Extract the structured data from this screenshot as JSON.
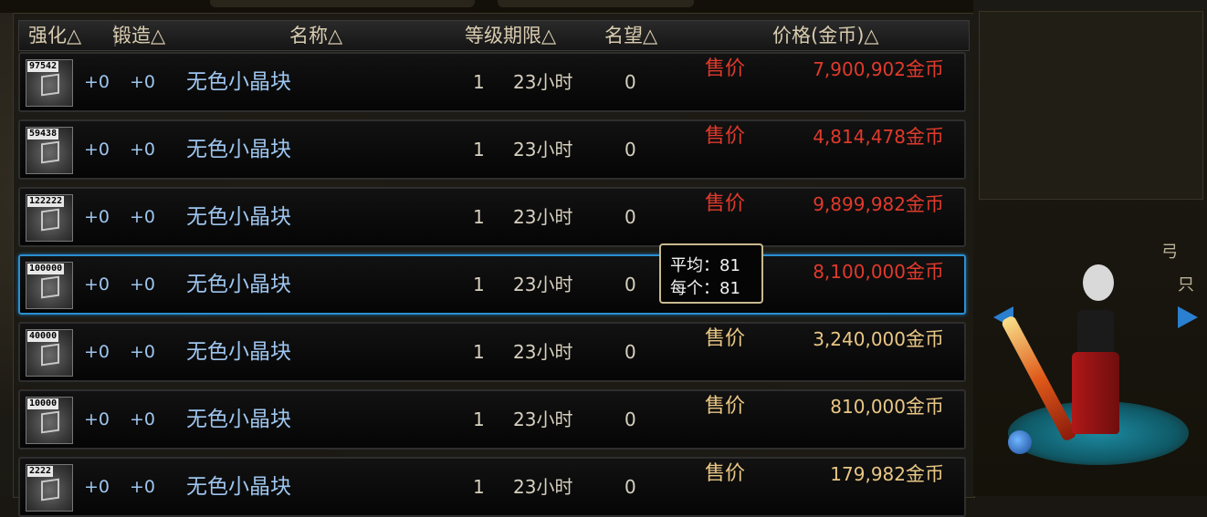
{
  "header": {
    "strengthen": "强化△",
    "forge": "锻造△",
    "name": "名称△",
    "level_duration": "等级期限△",
    "reputation": "名望△",
    "price": "价格(金币)△"
  },
  "rows": [
    {
      "qty": "97542",
      "strengthen": "+0",
      "forge": "+0",
      "name": "无色小晶块",
      "level": "1",
      "duration": "23小时",
      "reputation": "0",
      "sale_label": "售价",
      "price": "7,900,902",
      "unit": "金币",
      "price_color": "red"
    },
    {
      "qty": "59438",
      "strengthen": "+0",
      "forge": "+0",
      "name": "无色小晶块",
      "level": "1",
      "duration": "23小时",
      "reputation": "0",
      "sale_label": "售价",
      "price": "4,814,478",
      "unit": "金币",
      "price_color": "red"
    },
    {
      "qty": "122222",
      "strengthen": "+0",
      "forge": "+0",
      "name": "无色小晶块",
      "level": "1",
      "duration": "23小时",
      "reputation": "0",
      "sale_label": "售价",
      "price": "9,899,982",
      "unit": "金币",
      "price_color": "red"
    },
    {
      "qty": "100000",
      "strengthen": "+0",
      "forge": "+0",
      "name": "无色小晶块",
      "level": "1",
      "duration": "23小时",
      "reputation": "0",
      "sale_label": "",
      "price": "8,100,000",
      "unit": "金币",
      "price_color": "red",
      "selected": true
    },
    {
      "qty": "40000",
      "strengthen": "+0",
      "forge": "+0",
      "name": "无色小晶块",
      "level": "1",
      "duration": "23小时",
      "reputation": "0",
      "sale_label": "售价",
      "price": "3,240,000",
      "unit": "金币",
      "price_color": "gold"
    },
    {
      "qty": "10000",
      "strengthen": "+0",
      "forge": "+0",
      "name": "无色小晶块",
      "level": "1",
      "duration": "23小时",
      "reputation": "0",
      "sale_label": "售价",
      "price": "810,000",
      "unit": "金币",
      "price_color": "gold"
    },
    {
      "qty": "2222",
      "strengthen": "+0",
      "forge": "+0",
      "name": "无色小晶块",
      "level": "1",
      "duration": "23小时",
      "reputation": "0",
      "sale_label": "售价",
      "price": "179,982",
      "unit": "金币",
      "price_color": "gold"
    }
  ],
  "tooltip": {
    "line1": "平均：81",
    "line2": "每个：81"
  },
  "side": {
    "label1": "弓",
    "label2": "只"
  },
  "colors": {
    "red": "#e03a2c",
    "gold": "#e9c785",
    "selected_border": "#2a8fcf",
    "item_text": "#9ec5ee"
  }
}
